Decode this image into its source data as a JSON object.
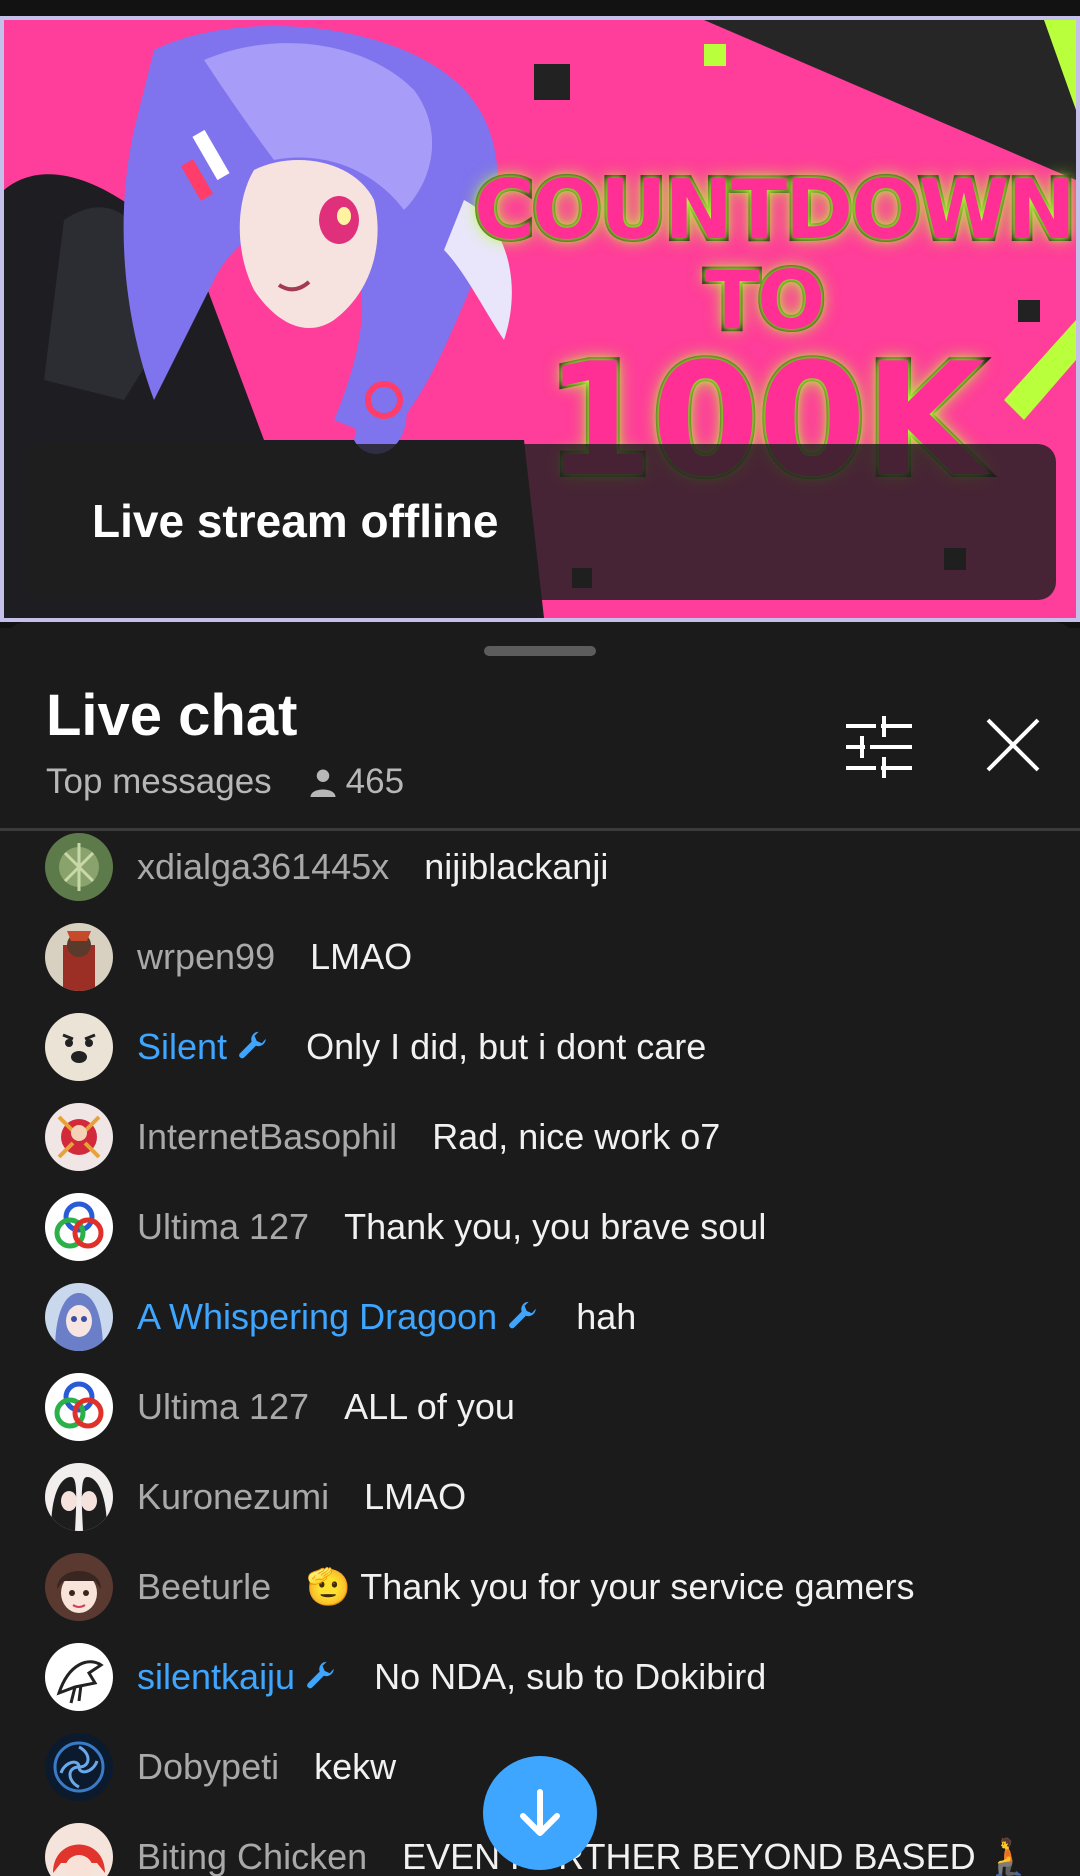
{
  "video": {
    "thumbnail_text_1": "COUNTDOWN",
    "thumbnail_text_2": "TO",
    "thumbnail_text_3": "100K",
    "status": "Live stream offline"
  },
  "chat": {
    "title": "Live chat",
    "mode": "Top messages",
    "viewer_count": "465",
    "filter_icon": "tune-icon",
    "close_icon": "close-icon"
  },
  "messages": [
    {
      "author": "xdialga361445x",
      "text": "nijiblackanji",
      "moderator": false
    },
    {
      "author": "wrpen99",
      "text": "LMAO",
      "moderator": false
    },
    {
      "author": "Silent",
      "text": "Only I did, but i dont care",
      "moderator": true
    },
    {
      "author": "InternetBasophil",
      "text": "Rad, nice work o7",
      "moderator": false
    },
    {
      "author": "Ultima 127",
      "text": "Thank you, you brave soul",
      "moderator": false
    },
    {
      "author": "A Whispering Dragoon",
      "text": "hah",
      "moderator": true
    },
    {
      "author": "Ultima 127",
      "text": "ALL of you",
      "moderator": false
    },
    {
      "author": "Kuronezumi",
      "text": "LMAO",
      "moderator": false
    },
    {
      "author": "Beeturle",
      "text": "🫡 Thank you for your service gamers",
      "moderator": false
    },
    {
      "author": "silentkaiju",
      "text": "No NDA, sub to Dokibird",
      "moderator": true
    },
    {
      "author": "Dobypeti",
      "text": "kekw",
      "moderator": false
    },
    {
      "author": "Biting Chicken",
      "text": "EVEN FURTHER BEYOND BASED 🧎",
      "moderator": false
    }
  ],
  "colors": {
    "moderator": "#3ea6ff",
    "author": "#a9a9a9",
    "background": "#1b1b1b",
    "thumbnail_pink": "#ff3d9a",
    "thumbnail_green": "#b9ff3c"
  },
  "scroll_button_icon": "arrow-down-icon"
}
